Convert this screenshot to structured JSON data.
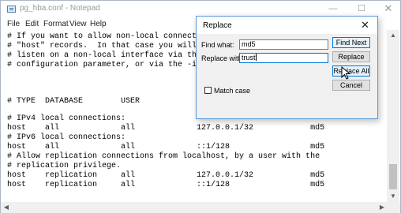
{
  "window": {
    "title": "pg_hba.conf - Notepad",
    "controls": {
      "minimize": "—",
      "maximize": "☐",
      "close": "✕"
    }
  },
  "menu": [
    "File",
    "Edit",
    "Format",
    "View",
    "Help"
  ],
  "editor_lines": [
    "# If you want to allow non-local connections,",
    "# \"host\" records.  In that case you will also",
    "# listen on a non-local interface via the list",
    "# configuration parameter, or via the -i or -h",
    "",
    "",
    "",
    "# TYPE  DATABASE        USER            ADDRES",
    "",
    "# IPv4 local connections:",
    "host    all             all             127.0.0.1/32            md5",
    "# IPv6 local connections:",
    "host    all             all             ::1/128                 md5",
    "# Allow replication connections from localhost, by a user with the",
    "# replication privilege.",
    "host    replication     all             127.0.0.1/32            md5",
    "host    replication     all             ::1/128                 md5"
  ],
  "scrollbar": {
    "up": "▲",
    "down": "▼",
    "left": "◀",
    "right": "▶"
  },
  "replace_dialog": {
    "title": "Replace",
    "close": "✕",
    "find_label": "Find what:",
    "find_value": "md5",
    "replace_label": "Replace with:",
    "replace_value": "trust",
    "match_case_label": "Match case",
    "match_case_checked": false,
    "buttons": {
      "find_next": "Find Next",
      "replace": "Replace",
      "replace_all": "Replace All",
      "cancel": "Cancel"
    }
  },
  "colors": {
    "accent": "#0078d7",
    "dialog_bg": "#f0f0f0",
    "border": "#5b9bd5"
  }
}
